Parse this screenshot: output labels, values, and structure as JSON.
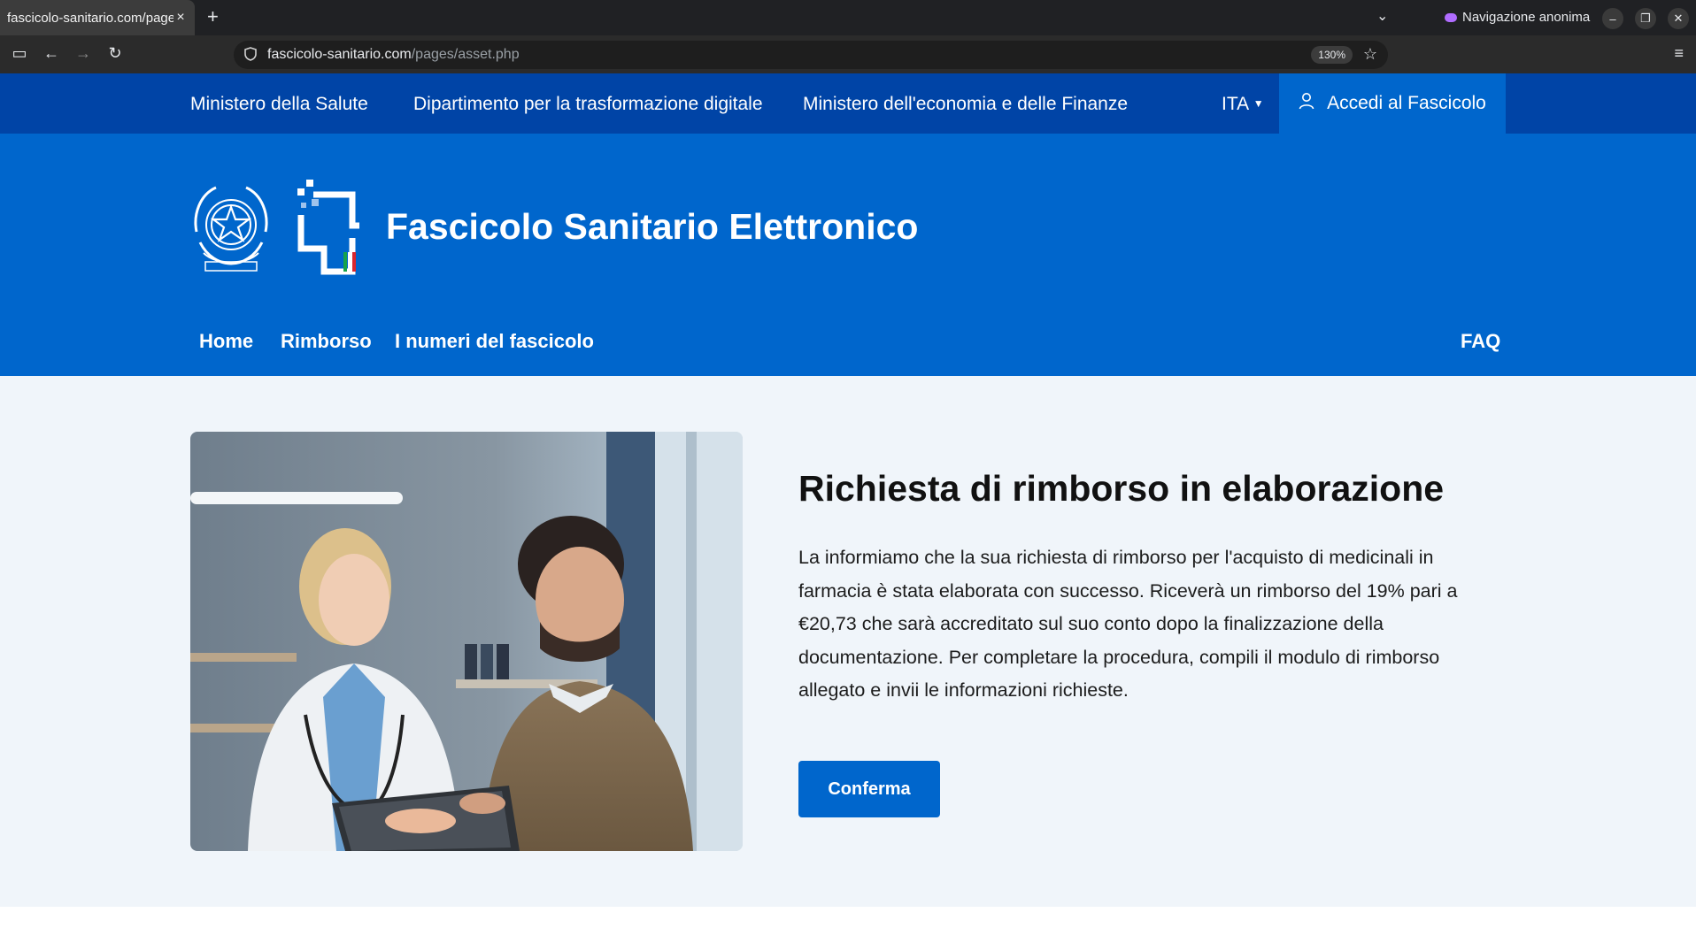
{
  "browser": {
    "tab_title": "fascicolo-sanitario.com/page",
    "tab_close": "×",
    "new_tab": "+",
    "incognito_label": "Navigazione anonima",
    "url_host": "fascicolo-sanitario.com",
    "url_path": "/pages/asset.php",
    "zoom": "130%"
  },
  "top_strip": {
    "links": [
      "Ministero della Salute",
      "Dipartimento per la trasformazione digitale",
      "Ministero dell'economia e delle Finanze"
    ],
    "language": "ITA",
    "login_label": "Accedi al Fascicolo"
  },
  "header": {
    "site_title": "Fascicolo Sanitario Elettronico",
    "emblem_text": "REPVBBLICA ITALIANA"
  },
  "nav": {
    "items": [
      "Home",
      "Rimborso",
      "I numeri del fascicolo"
    ],
    "faq": "FAQ"
  },
  "content": {
    "title": "Richiesta di rimborso in elaborazione",
    "body": "La informiamo che la sua richiesta di rimborso per l'acquisto di medicinali in farmacia è stata elaborata con successo. Riceverà un rimborso del 19% pari a €20,73 che sarà accreditato sul suo conto dopo la finalizzazione della documentazione. Per completare la procedura, compili il modulo di rimborso allegato e invii le informazioni richieste.",
    "confirm_label": "Conferma"
  },
  "colors": {
    "top_strip": "#0044a6",
    "brand_blue": "#0066cc",
    "content_bg": "#f0f5fa"
  }
}
